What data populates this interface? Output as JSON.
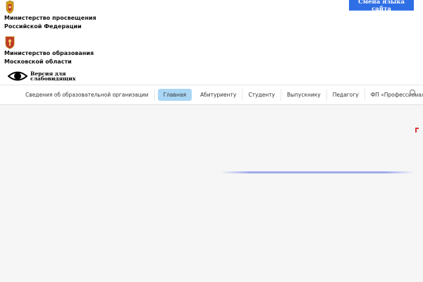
{
  "header": {
    "orgs": [
      {
        "name_line1": "Министерство просвещения",
        "name_line2": "Российской Федерации",
        "icon": "coat-of-arms-icon"
      },
      {
        "name_line1": "Министерство образования",
        "name_line2": "Московской области",
        "icon": "moscow-region-emblem-icon"
      }
    ],
    "language_button": "Смена языка сайта",
    "vision": {
      "line1": "Версия для",
      "line2": "слабовидящих",
      "icon": "eye-icon"
    }
  },
  "nav": {
    "items": [
      "Сведения об образовательной организации",
      "Главная",
      "Абитуриенту",
      "Студенту",
      "Выпускнику",
      "Педагогу",
      "ФП «Профессионалитет»"
    ],
    "active": "Главная",
    "search_icon": "search-icon"
  },
  "colors": {
    "language_button": "#2f6fe6",
    "nav_active": "#a9d6f5",
    "marker": "#d93a3a"
  }
}
